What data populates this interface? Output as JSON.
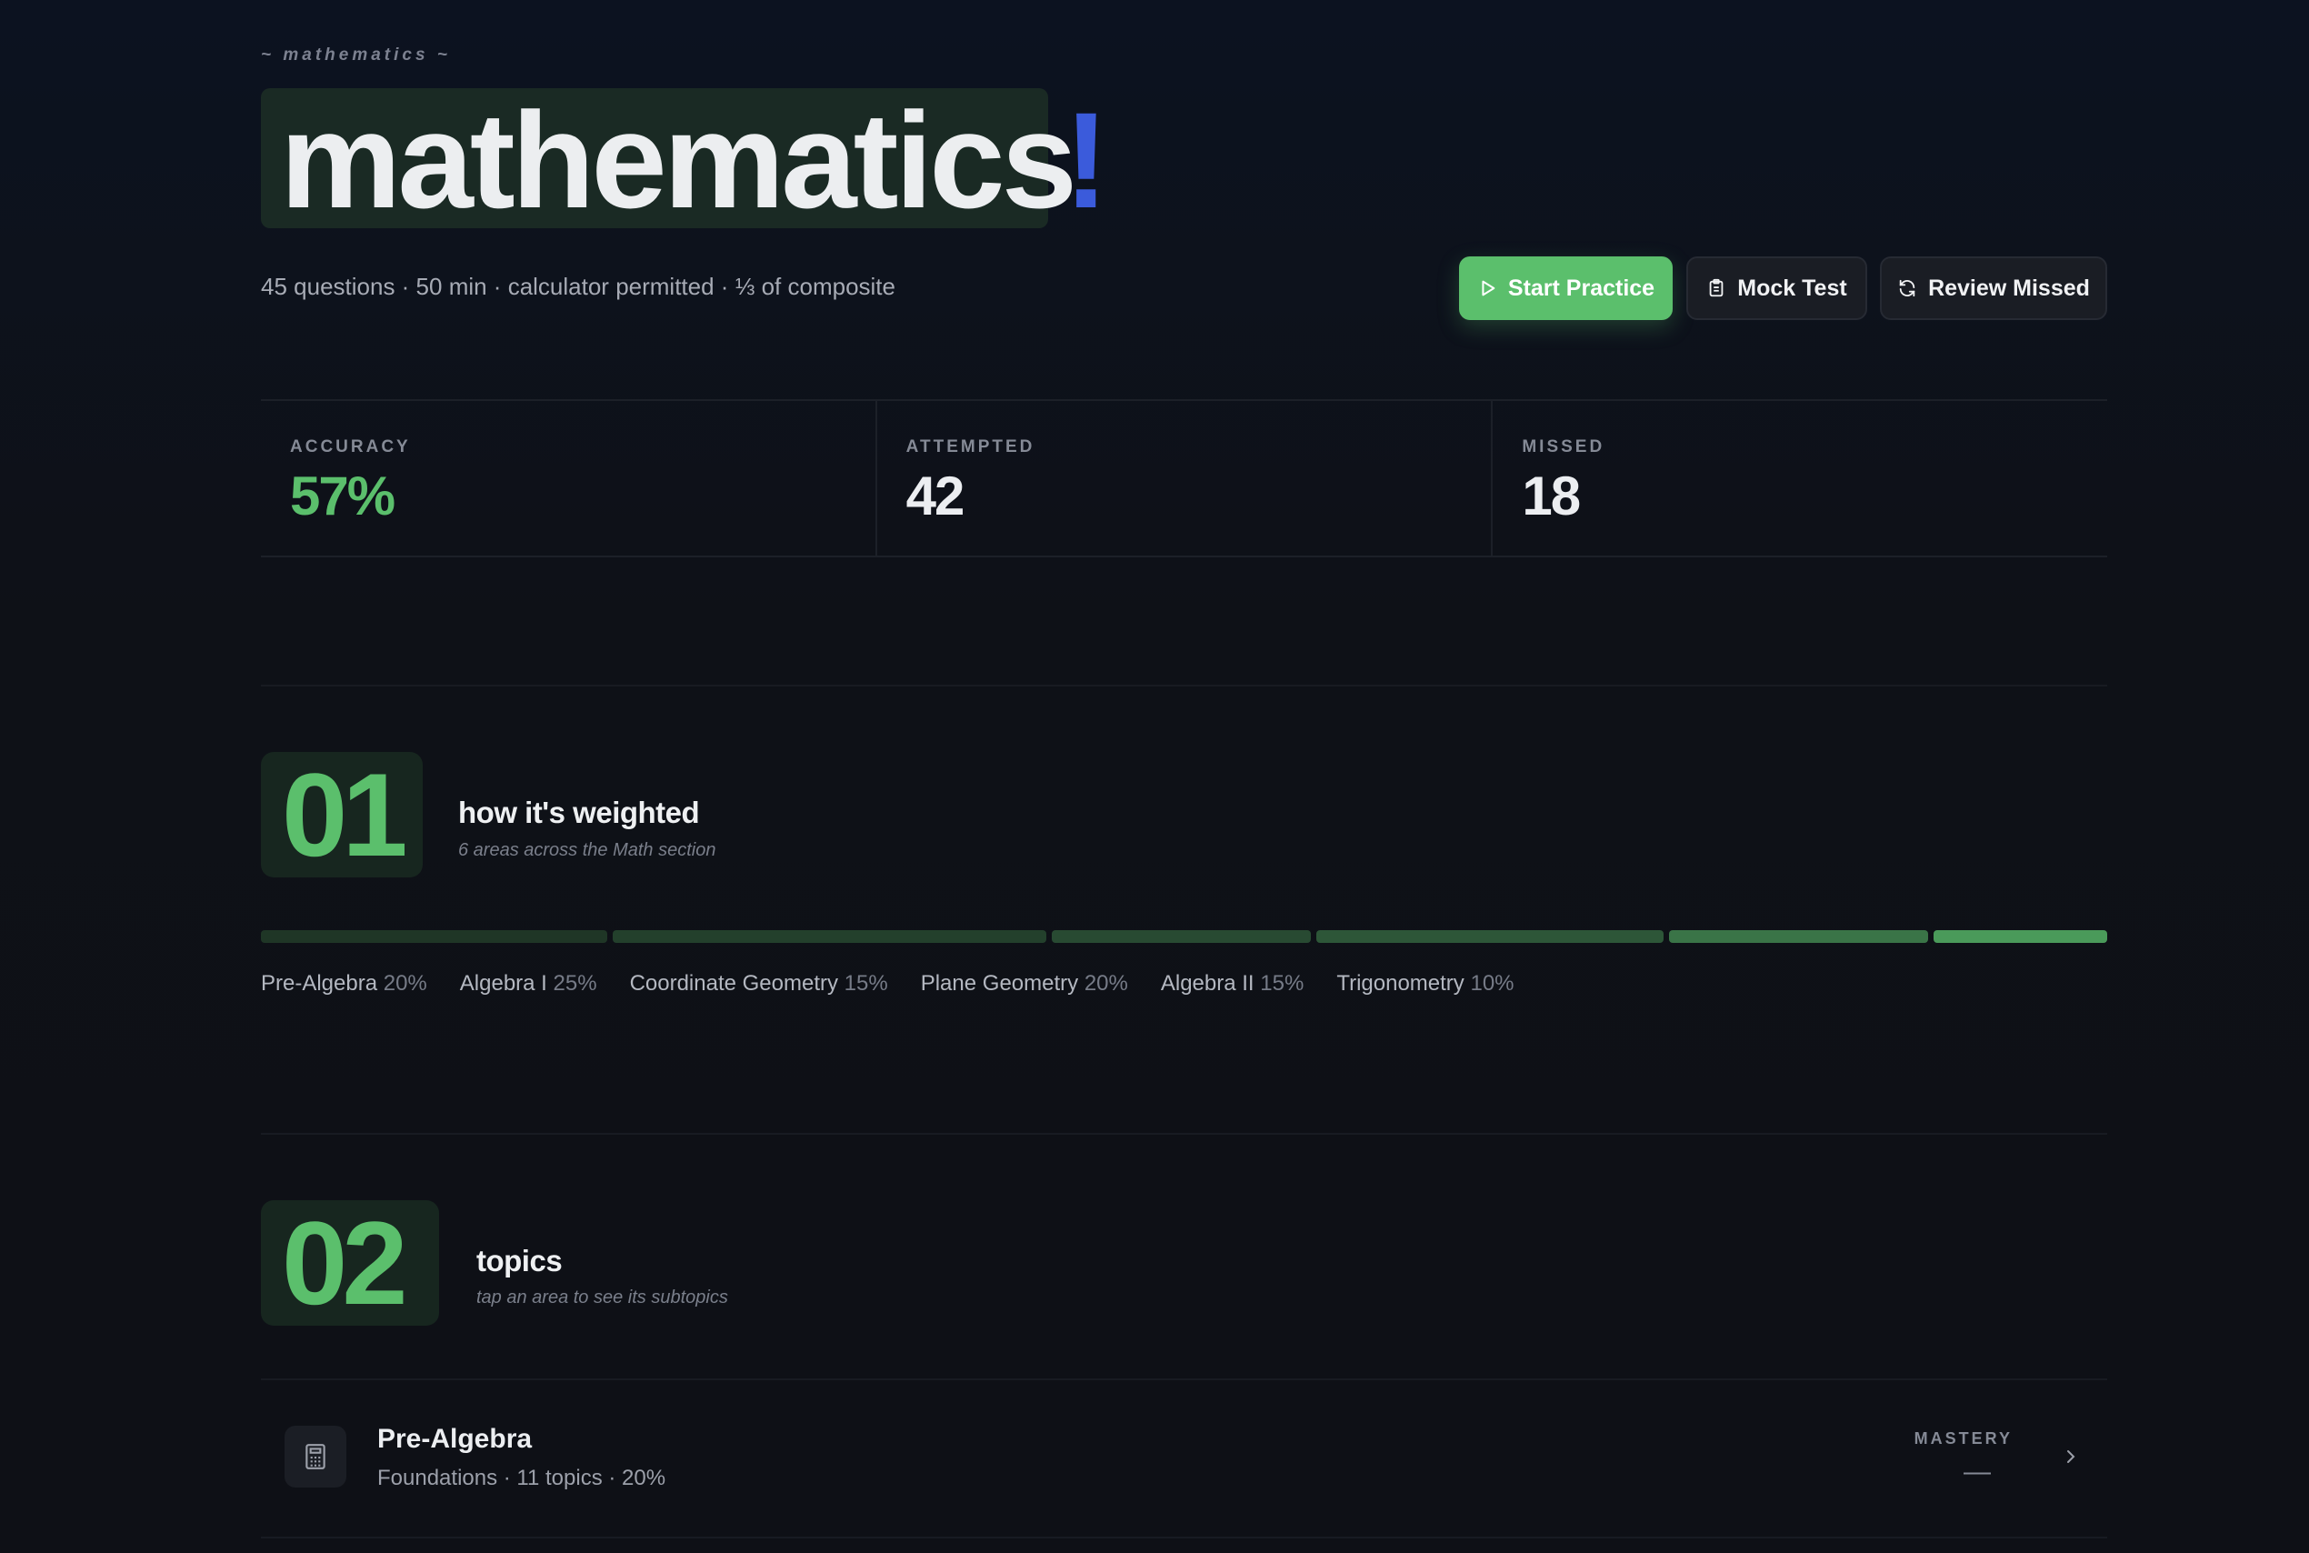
{
  "header": {
    "eyebrow": "~ mathematics ~",
    "title": "mathematics",
    "accent": "!",
    "meta": "45 questions · 50 min · calculator permitted · ⅓ of composite"
  },
  "actions": {
    "start_practice": "Start Practice",
    "mock_test": "Mock Test",
    "review_missed": "Review Missed"
  },
  "stats": [
    {
      "label": "ACCURACY",
      "value": "57%",
      "color": "#5bbf6c"
    },
    {
      "label": "ATTEMPTED",
      "value": "42",
      "color": "#eceef1"
    },
    {
      "label": "MISSED",
      "value": "18",
      "color": "#eceef1"
    }
  ],
  "section1": {
    "number": "01",
    "title": "how it's weighted",
    "subtitle": "6 areas across the Math section",
    "areas": [
      {
        "name": "Pre-Algebra",
        "pct": "20%",
        "weight": 20,
        "color": "#1f3626"
      },
      {
        "name": "Algebra I",
        "pct": "25%",
        "weight": 25,
        "color": "#23402c"
      },
      {
        "name": "Coordinate Geometry",
        "pct": "15%",
        "weight": 15,
        "color": "#284a32"
      },
      {
        "name": "Plane Geometry",
        "pct": "20%",
        "weight": 20,
        "color": "#2d5638"
      },
      {
        "name": "Algebra II",
        "pct": "15%",
        "weight": 15,
        "color": "#3a7447"
      },
      {
        "name": "Trigonometry",
        "pct": "10%",
        "weight": 10,
        "color": "#4a9a5a"
      }
    ]
  },
  "section2": {
    "number": "02",
    "title": "topics",
    "subtitle": "tap an area to see its subtopics"
  },
  "topics": [
    {
      "title": "Pre-Algebra",
      "subtitle": "Foundations · 11 topics · 20%",
      "mastery_label": "MASTERY",
      "mastery_value": "—"
    }
  ],
  "colors": {
    "accent_green": "#5bbf6c",
    "accent_blue": "#3b5bdb"
  }
}
